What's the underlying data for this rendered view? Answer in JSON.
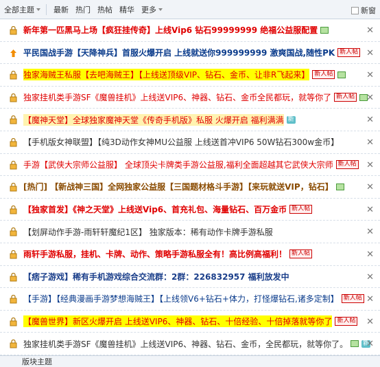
{
  "toolbar": {
    "all_topics": "全部主题",
    "latest": "最新",
    "hot": "热门",
    "hot_posts": "热帖",
    "digest": "精华",
    "more": "更多",
    "new_window": "新窗"
  },
  "rows": [
    {
      "p1": "新年第一匹黑马上场【疯狂挂传奇】上线Vip6 钻石99999999 绝福公益服配置",
      "badge": "",
      "hot": ""
    },
    {
      "p1": "平民国战手游【天降神兵】首服火爆开启 上线就送你999999999 激爽国战,随性PK",
      "badge": "新人帖",
      "hot": ""
    },
    {
      "p1": "独家海贼王私服【去吧海贼王】【上线送顶级VIP、钻石、金币、让非R飞起来】",
      "badge": "新人帖",
      "hot": ""
    },
    {
      "p1": "独家挂机类手游SF《魔兽挂机》上线送VIP6、神器、钻石、金币全民都玩，就等你了",
      "badge": "新人帖",
      "hot": ""
    },
    {
      "p1": "【魔神天堂】全球独家魔神天堂《传奇手机版》私服 火爆开启 福利满满",
      "badge": "",
      "hot": "新"
    },
    {
      "p1": "【手机版女神联盟】【纯3D动作女神MU公益服 上线送首冲VIP6 50W钻石300w金币】",
      "badge": "",
      "hot": ""
    },
    {
      "p1": "手游【武侠大宗师公益服】 全球顶尖卡牌类手游公益服,福利全面超越其它武侠大宗师",
      "badge": "新人帖",
      "hot": ""
    },
    {
      "p1": "[热门] 【新战神三国】全网独家公益服【三国题材格斗手游】【来玩就送VIP，钻石】",
      "badge": "",
      "hot": ""
    },
    {
      "p1": "【独家首发】《神之天堂》上线送Vip6、首充礼包、海量钻石、百万金币",
      "badge": "新人帖",
      "hot": ""
    },
    {
      "p1": "【划屏动作手游-雨轩轩魔纪1区】 独家版本：稀有动作卡牌手游私服",
      "badge": "",
      "hot": ""
    },
    {
      "p1": "雨轩手游私服，挂机、卡牌、动作、策略手游私服全有！高比例高福利！",
      "badge": "新人帖",
      "hot": ""
    },
    {
      "p1": "【痞子游戏】稀有手机游戏综合交流群：2群：226832957 福利放发中",
      "badge": "",
      "hot": ""
    },
    {
      "p1": "【手游】【经典漫画手游梦想海贼王】【上线领V6+钻石+体力，打怪爆钻石,诸多定制】",
      "badge": "新人帖",
      "hot": ""
    },
    {
      "p1": "【魔兽世界】新区火爆开启 上线送VIP6、神器、钻石、十倍经验、十倍掉落就等你了",
      "badge": "新人帖",
      "hot": ""
    },
    {
      "p1": "独家挂机类手游SF《魔兽挂机》上线送VIP6、神器、钻石、金币，全民都玩，就等你了。",
      "badge": "",
      "hot": "新"
    }
  ],
  "footer": {
    "label": "版块主题"
  },
  "colors": {
    "accent": "#e00000",
    "link": "#0b3c8c",
    "highlight": "#ffff00"
  }
}
